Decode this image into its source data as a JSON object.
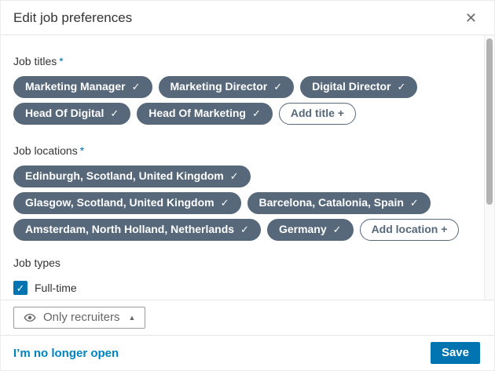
{
  "dialog": {
    "title": "Edit job preferences"
  },
  "glyphs": {
    "check": "✓",
    "close": "✕",
    "caret_up": "▲"
  },
  "job_titles": {
    "label": "Job titles",
    "required_marker": "*",
    "selected": [
      "Marketing Manager",
      "Marketing Director",
      "Digital Director",
      "Head Of Digital",
      "Head Of Marketing"
    ],
    "add_button_label": "Add title +"
  },
  "job_locations": {
    "label": "Job locations",
    "required_marker": "*",
    "selected": [
      "Edinburgh, Scotland, United Kingdom",
      "Glasgow, Scotland, United Kingdom",
      "Barcelona, Catalonia, Spain",
      "Amsterdam, North Holland, Netherlands",
      "Germany"
    ],
    "add_button_label": "Add location +"
  },
  "job_types": {
    "label": "Job types",
    "options": [
      {
        "label": "Full-time",
        "checked": true
      }
    ]
  },
  "visibility": {
    "button_label": "Only recruiters"
  },
  "footer": {
    "link_label": "I’m no longer open",
    "save_label": "Save"
  },
  "colors": {
    "pill_bg": "#56687a",
    "accent_blue": "#0073b1",
    "link_blue": "#0084bf",
    "border_gray": "#e6e6e6"
  }
}
